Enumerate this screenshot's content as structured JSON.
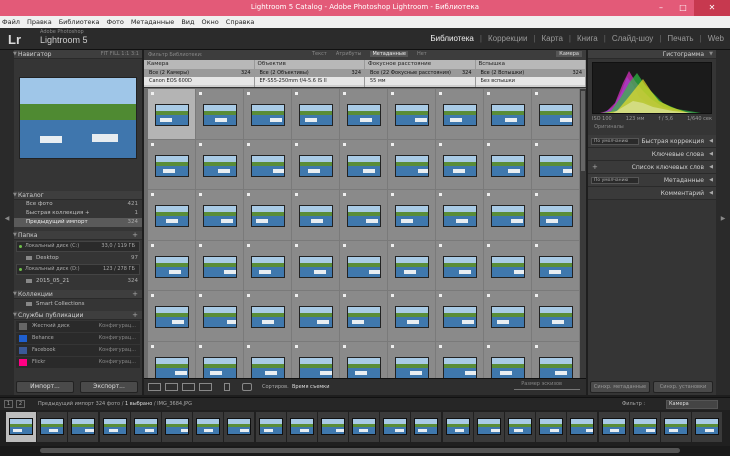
{
  "window": {
    "title": "Lightroom 5 Catalog - Adobe Photoshop Lightroom - Библиотека"
  },
  "menu": [
    "Файл",
    "Правка",
    "Библиотека",
    "Фото",
    "Метаданные",
    "Вид",
    "Окно",
    "Справка"
  ],
  "identity": {
    "logo": "Lr",
    "adobe": "Adobe Photoshop",
    "product": "Lightroom 5"
  },
  "modules": [
    "Библиотека",
    "Коррекции",
    "Карта",
    "Книга",
    "Слайд-шоу",
    "Печать",
    "Web"
  ],
  "navigator": {
    "title": "Навигатор",
    "zoom": "FIT   FILL   1:1   3:1"
  },
  "catalog": {
    "title": "Каталог",
    "items": [
      {
        "label": "Все фото",
        "count": "421"
      },
      {
        "label": "Быстрая коллекция +",
        "count": "1"
      },
      {
        "label": "Предыдущий импорт",
        "count": "324"
      }
    ]
  },
  "folders": {
    "title": "Папка",
    "volumes": [
      {
        "label": "Локальный диск (C:)",
        "info": "33,0 / 119 ГБ"
      },
      {
        "label": "Локальный диск (D:)",
        "info": "123 / 278 ГБ"
      }
    ],
    "items": [
      {
        "label": "Desktop",
        "count": "97"
      },
      {
        "label": "2015_05_21",
        "count": "324"
      }
    ]
  },
  "collections": {
    "title": "Коллекции",
    "smart": "Smart Collections"
  },
  "publish": {
    "title": "Службы публикации",
    "items": [
      {
        "label": "Жесткий диск",
        "action": "Конфигурац..."
      },
      {
        "label": "Behance",
        "action": "Конфигурац..."
      },
      {
        "label": "Facebook",
        "action": "Конфигурац..."
      },
      {
        "label": "Flickr",
        "action": "Конфигурац..."
      }
    ]
  },
  "left_buttons": {
    "import": "Импорт...",
    "export": "Экспорт..."
  },
  "library_filter": {
    "label": "Фильтр Библиотеки:",
    "tabs": [
      "Текст",
      "Атрибуты",
      "Метаданные",
      "Нет"
    ],
    "active_tab": "Метаданные",
    "preset": "Камера"
  },
  "metadata_columns": [
    {
      "header": "Камера",
      "rows": [
        {
          "label": "Все (2 Камеры)",
          "count": "324"
        },
        {
          "label": "Canon EOS 600D",
          "count": ""
        }
      ]
    },
    {
      "header": "Объектив",
      "rows": [
        {
          "label": "Все (2 Объективы)",
          "count": "324"
        },
        {
          "label": "EF-S55-250mm f/4-5.6 IS II",
          "count": ""
        }
      ]
    },
    {
      "header": "Фокусное расстояние",
      "rows": [
        {
          "label": "Все (22 Фокусные расстояния)",
          "count": "324"
        },
        {
          "label": "55 мм",
          "count": ""
        }
      ]
    },
    {
      "header": "Вспышка",
      "rows": [
        {
          "label": "Все (2 Вспышки)",
          "count": "324"
        },
        {
          "label": "Без вспышки",
          "count": ""
        }
      ]
    }
  ],
  "toolbar": {
    "sort_label": "Сортиров.",
    "sort_value": "Время съемки",
    "thumb_label": "Размер эскизов"
  },
  "histogram": {
    "title": "Гистограмма",
    "iso": "ISO 100",
    "focal": "123 мм",
    "aperture": "f / 5,6",
    "shutter": "1/640 сек",
    "original": "Оригиналы"
  },
  "right_panels": [
    {
      "label": "Быстрая коррекция",
      "dropdown": "По умолчанию"
    },
    {
      "label": "Ключевые слова",
      "dropdown": ""
    },
    {
      "label": "Список ключевых слов",
      "dropdown": ""
    },
    {
      "label": "Метаданные",
      "dropdown": "По умолчанию"
    },
    {
      "label": "Комментарий",
      "dropdown": ""
    }
  ],
  "right_buttons": {
    "sync_meta": "Синхр. метаданные",
    "sync_settings": "Синхр. установки"
  },
  "filmstrip_bar": {
    "pages": [
      "1",
      "2"
    ],
    "path_prefix": "Предыдущий импорт",
    "path_count": "324 фото /",
    "path_selected": "1 выбрано",
    "path_file": "/ IMG_3684.JPG",
    "filter_label": "Фильтр :",
    "filter_value": "Камера"
  },
  "colors": {
    "title_bar": "#e35a78",
    "close_button": "#c7394f",
    "panel": "#353535",
    "grid": "#6e6e6e"
  }
}
